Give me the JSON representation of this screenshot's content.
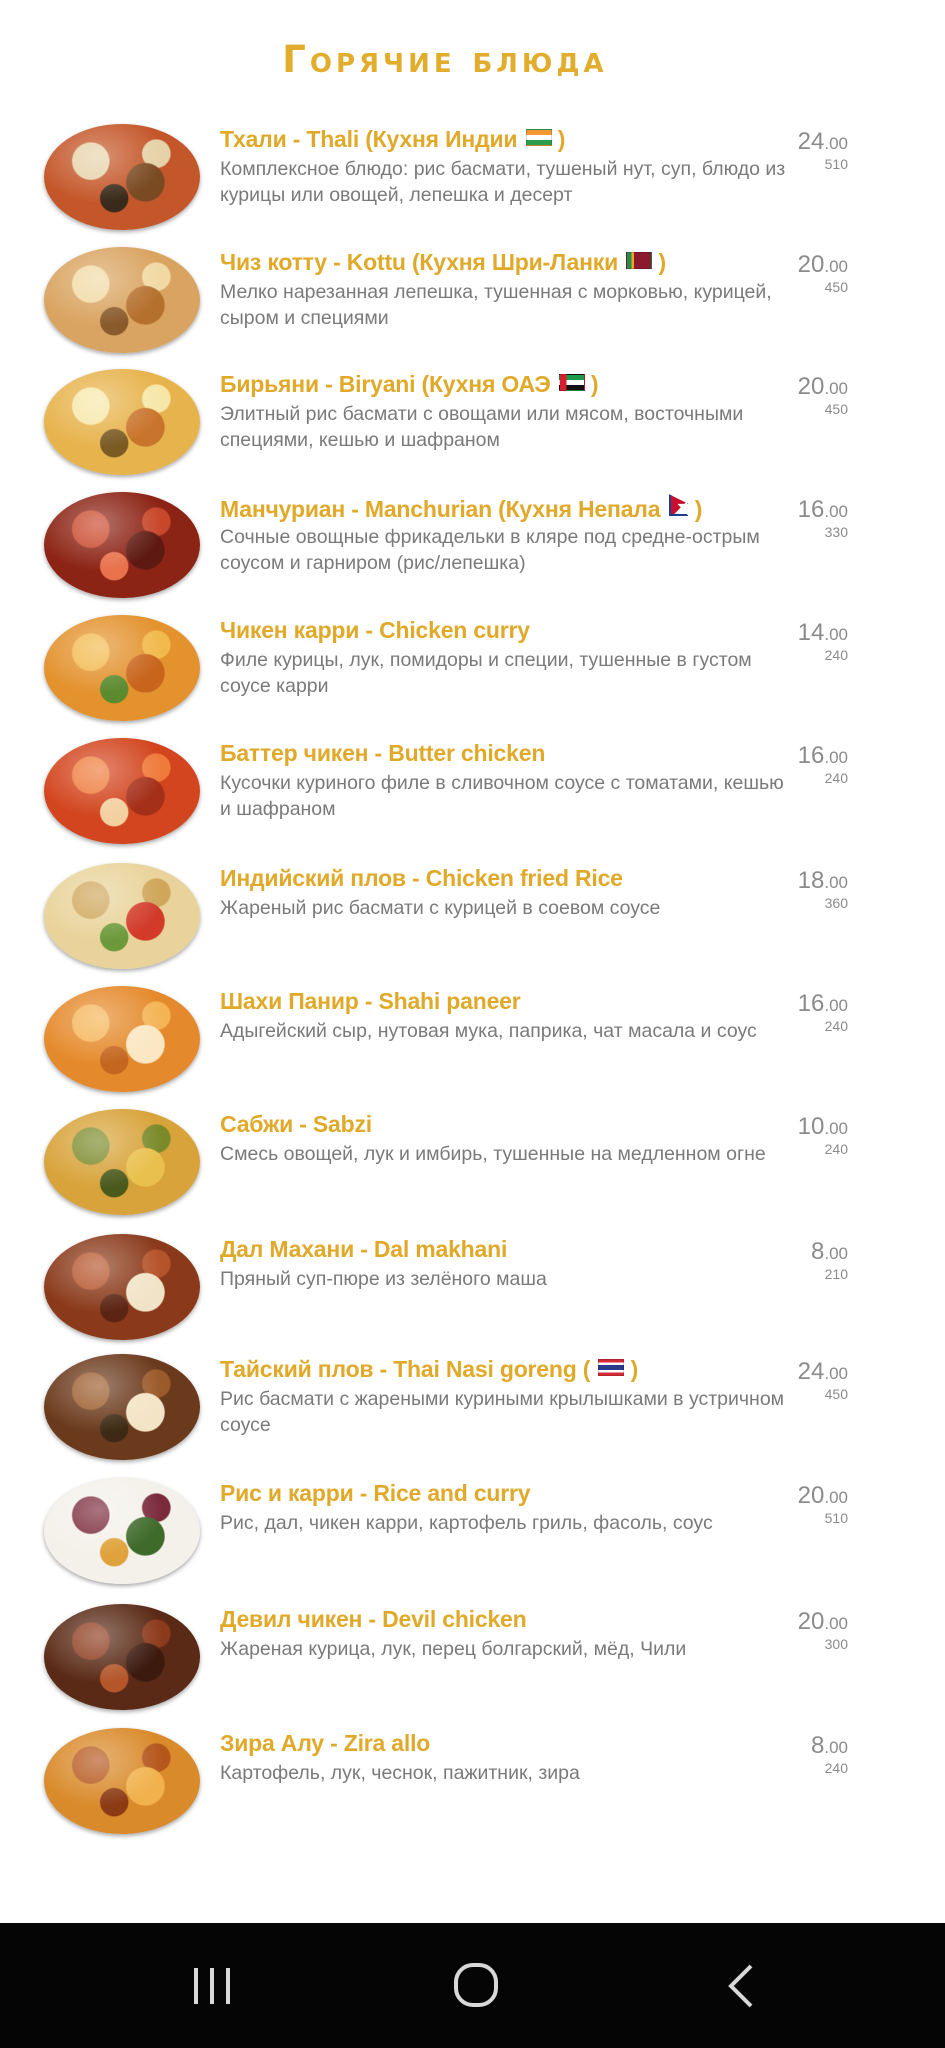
{
  "page": {
    "title": "Горячие блюда"
  },
  "items": [
    {
      "name": "Тхали - Thali (Кухня Индии",
      "flag": "india-flag",
      "suffix": ")",
      "desc": "Комплексное блюдо: рис басмати, тушеный нут, суп, блюдо из курицы или овощей, лепешка и десерт",
      "price": "24",
      "cents": ".00",
      "weight": "510",
      "photo": [
        "#c4572a",
        "#e6d2a8",
        "#7a4a22",
        "#3a2a1c"
      ]
    },
    {
      "name": "Чиз котту - Kottu (Кухня Шри-Ланки",
      "flag": "sri-lanka-flag",
      "suffix": ")",
      "desc": "Мелко нарезанная лепешка, тушенная с морковью, курицей, сыром и специями",
      "price": "20",
      "cents": ".00",
      "weight": "450",
      "photo": [
        "#d9a461",
        "#f1d9a4",
        "#b5702e",
        "#8a5a2c"
      ]
    },
    {
      "name": "Бирьяни - Biryani (Кухня ОАЭ",
      "flag": "uae-flag",
      "suffix": ")",
      "desc": "Элитный рис басмати с овощами или мясом, восточными специями, кешью и шафраном",
      "price": "20",
      "cents": ".00",
      "weight": "450",
      "photo": [
        "#e7b34c",
        "#f6e7a8",
        "#c9742c",
        "#7b5a24"
      ]
    },
    {
      "name": "Манчуриан - Manchurian (Кухня Непала",
      "flag": "nepal-flag",
      "suffix": ")",
      "desc": "Сочные овощные фрикадельки в кляре под средне-острым соусом и гарниром (рис/лепешка)",
      "price": "16",
      "cents": ".00",
      "weight": "330",
      "photo": [
        "#8c2415",
        "#c8462a",
        "#5e1a12",
        "#e8724c"
      ]
    },
    {
      "name": "Чикен карри - Chicken curry",
      "flag": "",
      "suffix": "",
      "desc": "Филе курицы, лук, помидоры и специи, тушенные в густом соусе карри",
      "price": "14",
      "cents": ".00",
      "weight": "240",
      "photo": [
        "#e3922e",
        "#f2b94d",
        "#c8641c",
        "#5c8a2e"
      ]
    },
    {
      "name": "Баттер чикен - Butter chicken",
      "flag": "",
      "suffix": "",
      "desc": "Кусочки куриного филе в сливочном соусе с томатами, кешью и шафраном",
      "price": "16",
      "cents": ".00",
      "weight": "240",
      "photo": [
        "#d2451e",
        "#ee7a3b",
        "#a5301a",
        "#f3d0a0"
      ]
    },
    {
      "name": "Индийский плов - Chicken fried Rice",
      "flag": "",
      "suffix": "",
      "desc": "Жареный рис басмати с курицей в соевом соусе",
      "price": "18",
      "cents": ".00",
      "weight": "360",
      "photo": [
        "#e9d39a",
        "#cfa65a",
        "#d23b2a",
        "#6c9a3a"
      ]
    },
    {
      "name": "Шахи Панир - Shahi paneer",
      "flag": "",
      "suffix": "",
      "desc": "Адыгейский сыр, нутовая мука, паприка, чат масала и соус",
      "price": "16",
      "cents": ".00",
      "weight": "240",
      "photo": [
        "#e58a2c",
        "#f4b456",
        "#fbe7c3",
        "#c4661e"
      ]
    },
    {
      "name": "Сабжи - Sabzi",
      "flag": "",
      "suffix": "",
      "desc": "Смесь овощей, лук и имбирь, тушенные на медленном огне",
      "price": "10",
      "cents": ".00",
      "weight": "240",
      "photo": [
        "#d8a33a",
        "#7a8a2a",
        "#e9c04e",
        "#4a5a1c"
      ]
    },
    {
      "name": "Дал Махани - Dal makhani",
      "flag": "",
      "suffix": "",
      "desc": "Пряный суп-пюре из зелёного маша",
      "price": "8",
      "cents": ".00",
      "weight": "210",
      "photo": [
        "#8a3a1a",
        "#b5532a",
        "#f1e3c8",
        "#5c2412"
      ]
    },
    {
      "name": "Тайский плов - Thai Nasi goreng (",
      "flag": "thailand-flag",
      "suffix": ")",
      "desc": "Рис басмати с жареными куриными крылышками в устричном соусе",
      "price": "24",
      "cents": ".00",
      "weight": "450",
      "photo": [
        "#6b3a1c",
        "#9a5a2a",
        "#f3e4c5",
        "#3e2a14"
      ]
    },
    {
      "name": "Рис и карри  - Rice and curry",
      "flag": "",
      "suffix": "",
      "desc": "Рис, дал, чикен карри, картофель гриль, фасоль, соус",
      "price": "20",
      "cents": ".00",
      "weight": "510",
      "photo": [
        "#f4f1ea",
        "#7a2a3a",
        "#3e6a2a",
        "#e0a23a"
      ]
    },
    {
      "name": "Девил чикен - Devil chicken",
      "flag": "",
      "suffix": "",
      "desc": "Жареная курица, лук, перец болгарский, мёд, Чили",
      "price": "20",
      "cents": ".00",
      "weight": "300",
      "photo": [
        "#5a2a16",
        "#8c3a1c",
        "#3c1a0e",
        "#b4562a"
      ]
    },
    {
      "name": "Зира Алу -  Zira allo",
      "flag": "",
      "suffix": "",
      "desc": "Картофель, лук, чеснок, пажитник, зира",
      "price": "8",
      "cents": ".00",
      "weight": "240",
      "photo": [
        "#d98a2a",
        "#b5561c",
        "#f1b24e",
        "#8c3a14"
      ]
    }
  ],
  "navbar": {
    "recent": "recent-apps-icon",
    "home": "home-icon",
    "back": "back-icon"
  }
}
